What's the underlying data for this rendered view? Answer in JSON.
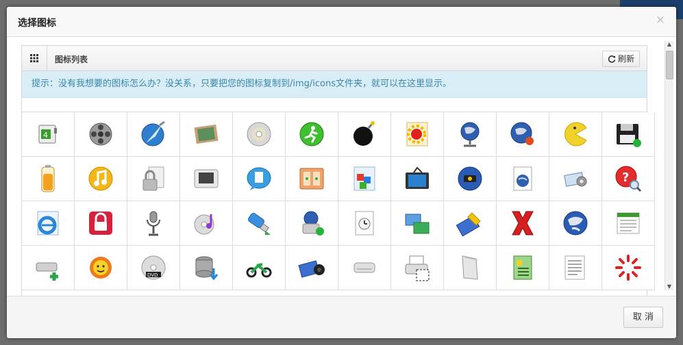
{
  "dialog": {
    "title": "选择图标",
    "close_label": "×",
    "cancel_label": "取 消"
  },
  "panel": {
    "title": "图标列表",
    "refresh_label": "刷新"
  },
  "alert": {
    "text": "提示：没有我想要的图标怎么办？没关系，只要把您的图标复制到/img/icons文件夹，就可以在这里显示。"
  },
  "icons": [
    [
      "battery-charge-icon",
      "film-reel-icon",
      "safari-compass-icon",
      "chalkboard-icon",
      "cd-disc-icon",
      "runner-icon",
      "bomb-icon",
      "flower-document-icon",
      "globe-network-icon",
      "globe-plug-icon",
      "pacman-icon",
      "floppy-disk-icon"
    ],
    [
      "battery-icon",
      "music-note-icon",
      "lock-document-icon",
      "tablet-icon",
      "chat-document-icon",
      "control-panel-icon",
      "cubes-document-icon",
      "television-icon",
      "globe-router-icon",
      "globe-document-icon",
      "settings-display-icon",
      "help-magnifier-icon"
    ],
    [
      "internet-explorer-icon",
      "padlock-icon",
      "microphone-icon",
      "music-cd-icon",
      "usb-drive-icon",
      "globe-user-icon",
      "clock-document-icon",
      "monitors-network-icon",
      "battery-edit-icon",
      "red-x-icon",
      "world-globe-icon",
      "news-document-icon"
    ],
    [
      "drive-add-icon",
      "sun-flower-icon",
      "dvd-disc-icon",
      "database-download-icon",
      "motorcycle-icon",
      "camera-projector-icon",
      "drive-icon",
      "printer-icon",
      "document-icon",
      "green-board-icon",
      "text-document-icon",
      "loading-spinner-icon"
    ]
  ],
  "colors": {
    "alert_bg": "#d9edf7",
    "alert_text": "#3a87ad"
  }
}
